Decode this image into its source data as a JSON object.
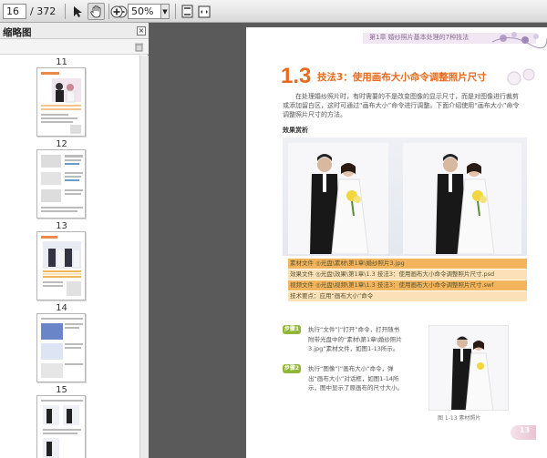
{
  "toolbar": {
    "page_current": "16",
    "page_total": "/ 372",
    "zoom": "50%",
    "icons": [
      "select-arrow-icon",
      "hand-tool-icon",
      "zoom-out-icon",
      "zoom-in-icon",
      "fit-page-icon",
      "fit-width-icon"
    ]
  },
  "panel": {
    "title": "缩略图",
    "close": "×",
    "thumbs": [
      {
        "label": "11"
      },
      {
        "label": "12"
      },
      {
        "label": "13"
      },
      {
        "label": "14"
      },
      {
        "label": "15"
      }
    ]
  },
  "page": {
    "running_head": "第1章  婚纱照片基本处理的7种技法",
    "section_number": "1.3",
    "section_title": "技法3：使用画布大小命令调整照片尺寸",
    "intro": "在处理婚纱照片时，有时需要的不是改变图像的显示尺寸，而是对图像进行裁剪或添加留白区，这时可通过“画布大小”命令进行调整。下面介绍使用“画布大小”命令调整照片尺寸的方法。",
    "effect_label": "效果赏析",
    "files": [
      "素材文件 ◎光盘\\素材\\第1章\\婚纱照片3.jpg",
      "效果文件 ◎光盘\\效果\\第1章\\1.3 技法3：使用画布大小命令调整照片尺寸.psd",
      "视频文件 ◎光盘\\视频\\第1章\\1.3 技法3：使用画布大小命令调整照片尺寸.swf",
      "技术要点：应用“画布大小”命令"
    ],
    "steps": [
      {
        "badge": "步骤1",
        "text": "执行“文件”|“打开”命令，打开随书附带光盘中的“素材\\第1章\\婚纱照片3.jpg”素材文件，如图1-13所示。"
      },
      {
        "badge": "步骤2",
        "text": "执行“图像”|“画布大小”命令，弹出“画布大小”对话框，如图1-14所示，图中显示了原画布的尺寸大小。"
      }
    ],
    "caption": "图 1-13   素材照片",
    "page_number": "13"
  },
  "colors": {
    "accent_orange": "#e96a1e",
    "step_green": "#8fb634",
    "file_row": "#f4b45c"
  }
}
